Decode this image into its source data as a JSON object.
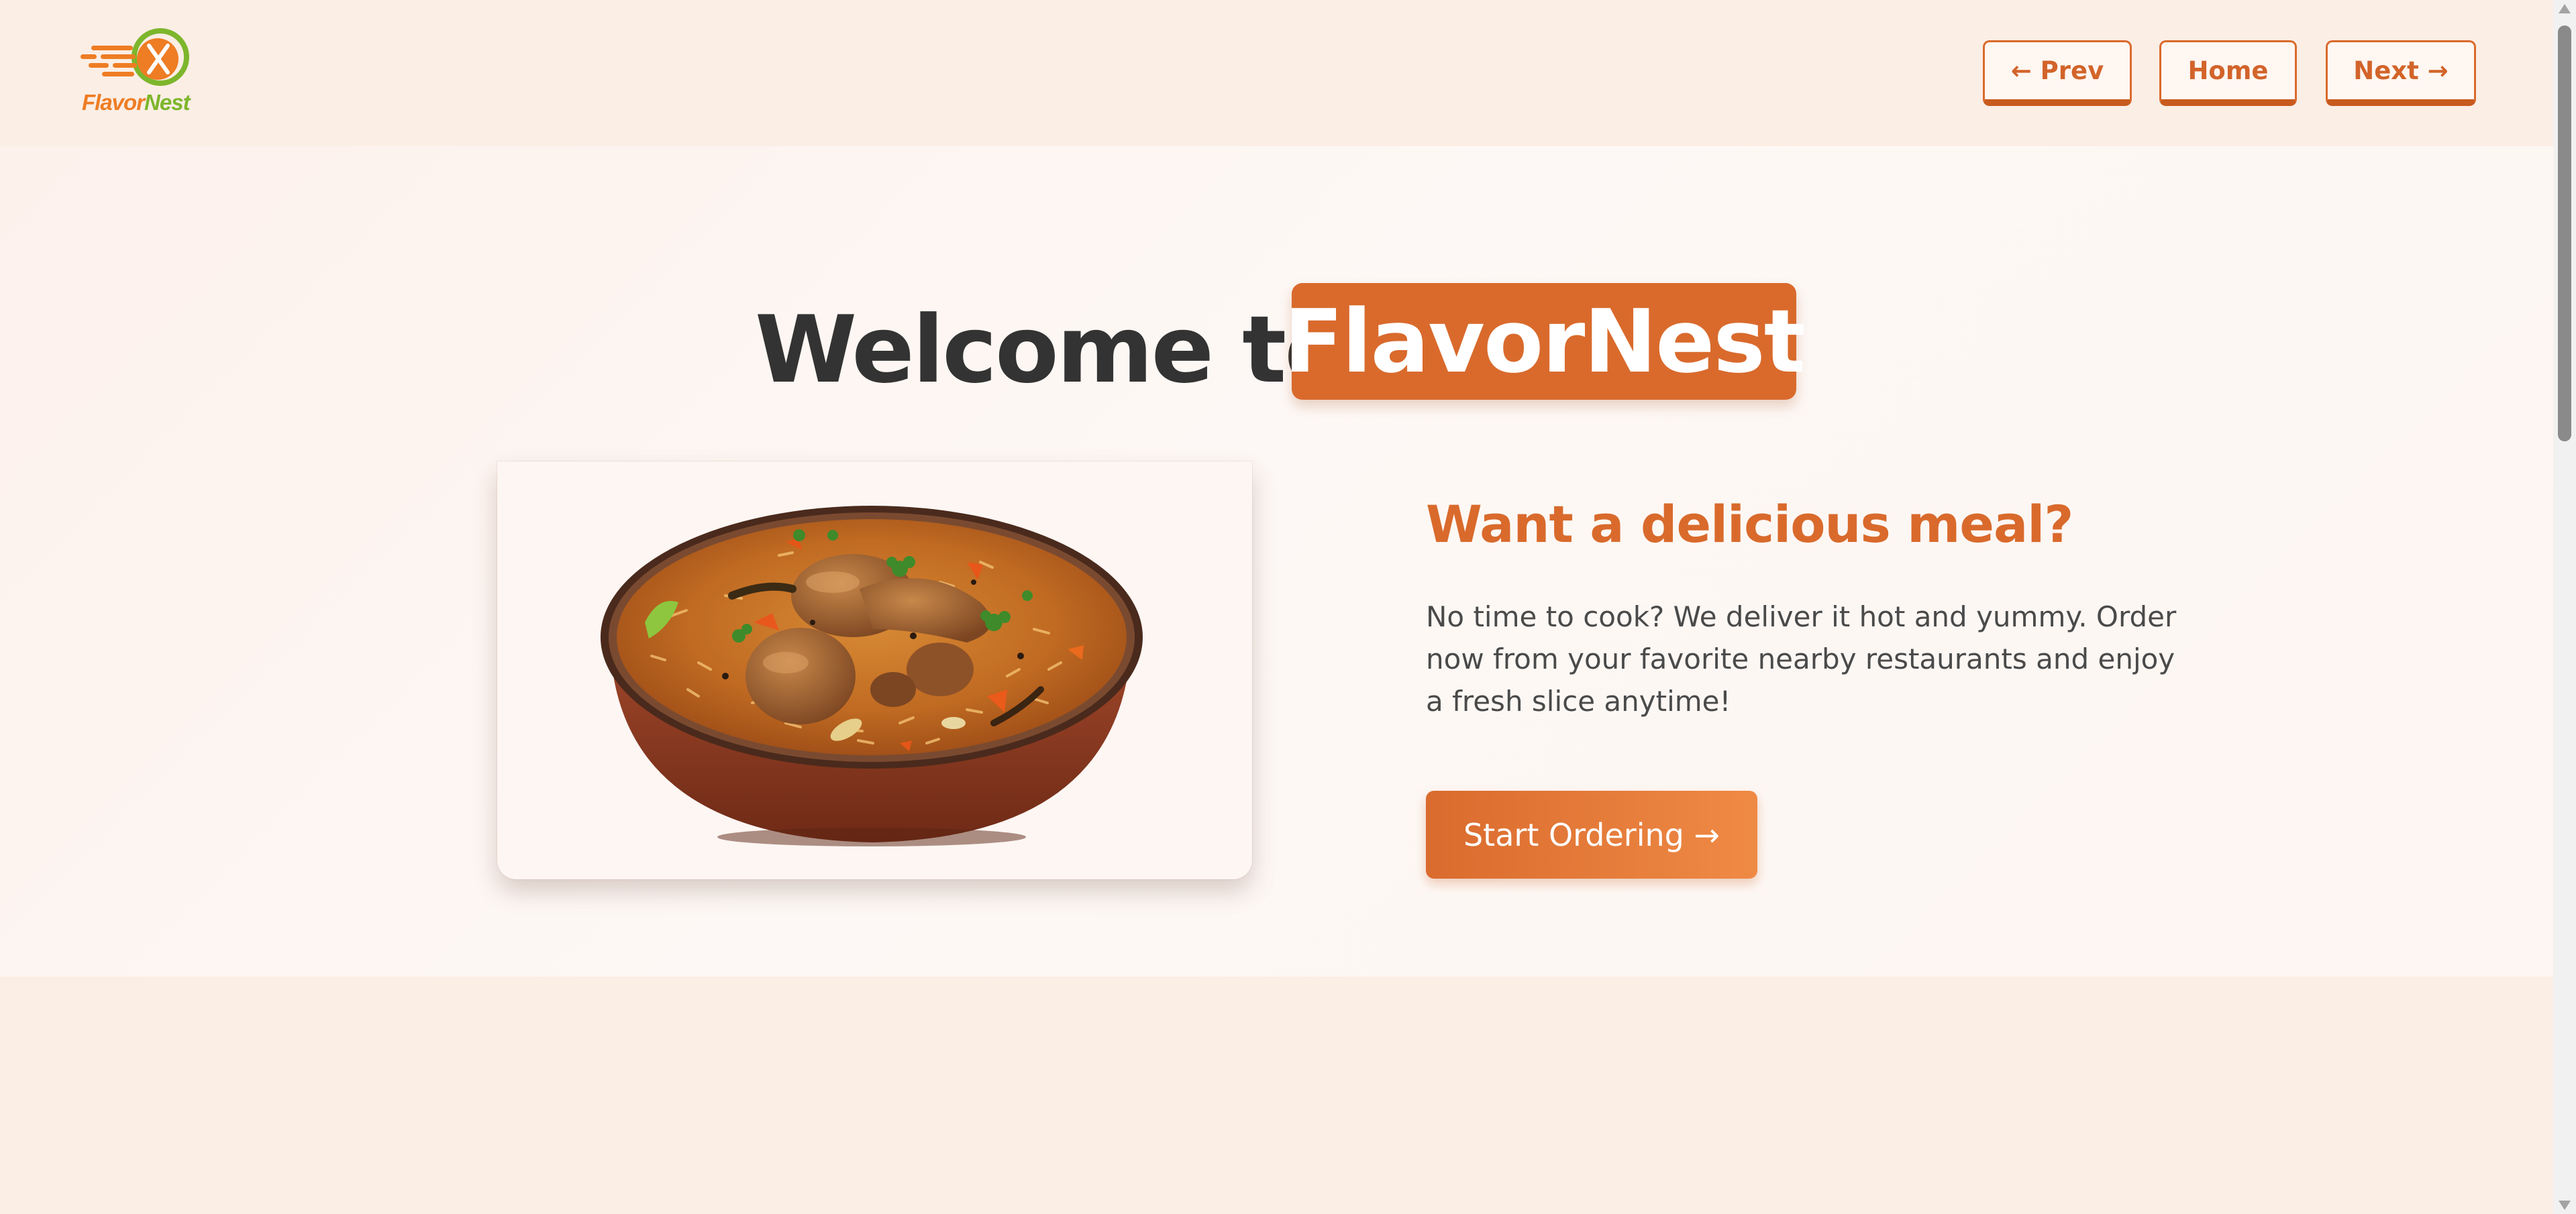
{
  "header": {
    "logo": {
      "part1": "Flavor",
      "part2": "Nest",
      "colors": {
        "orange": "#ee7d24",
        "green": "#7db62c"
      }
    },
    "nav": {
      "prev_label": "← Prev",
      "home_label": "Home",
      "next_label": "Next →"
    }
  },
  "hero": {
    "welcome_prefix": "Welcome to",
    "brand": "FlavorNest",
    "image_alt": "bowl-of-chicken-biryani",
    "headline": "Want a delicious meal?",
    "body": "No time to cook? We deliver it hot and yummy. Order now from your favorite nearby restaurants and enjoy a fresh slice anytime!",
    "cta_label": "Start Ordering →"
  },
  "colors": {
    "accent": "#d96a2c",
    "page_bg": "#fbeee5",
    "hero_bg": "#fdf7f3",
    "heading_text": "#333333",
    "body_text": "#4a4a4a"
  }
}
